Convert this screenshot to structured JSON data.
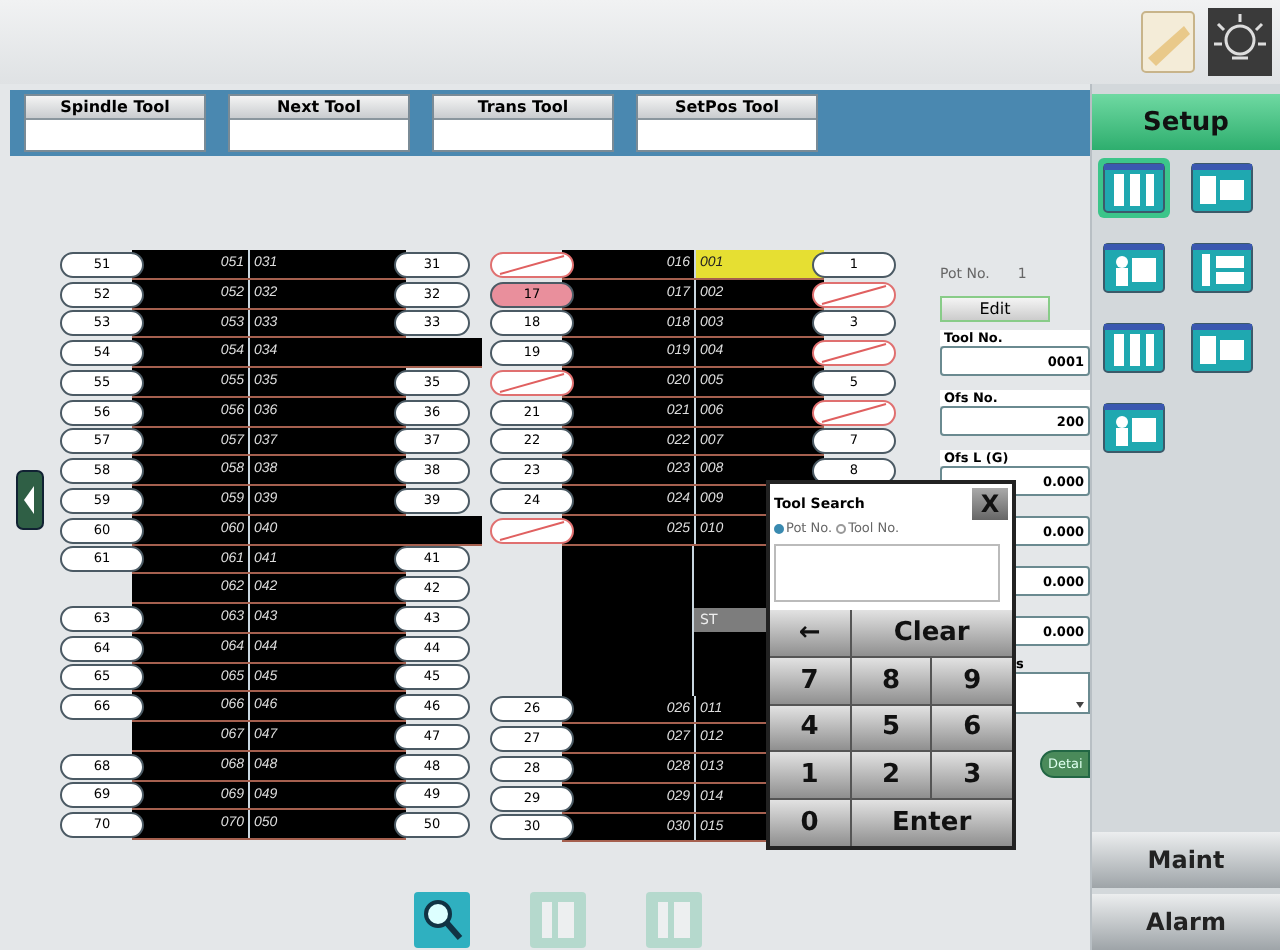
{
  "tool_tabs": [
    {
      "label": "Spindle Tool"
    },
    {
      "label": "Next Tool"
    },
    {
      "label": "Trans Tool"
    },
    {
      "label": "SetPos Tool"
    }
  ],
  "magazine_a": [
    {
      "left": {
        "kind": "number",
        "text": "51"
      },
      "number": "051",
      "tool": "031",
      "right": {
        "kind": "number",
        "text": "31"
      }
    },
    {
      "left": {
        "kind": "number",
        "text": "52"
      },
      "number": "052",
      "tool": "032",
      "right": {
        "kind": "number",
        "text": "32"
      }
    },
    {
      "left": {
        "kind": "number",
        "text": "53"
      },
      "number": "053",
      "tool": "033",
      "right": {
        "kind": "number",
        "text": "33"
      }
    },
    {
      "left": {
        "kind": "number",
        "text": "54"
      },
      "number": "054",
      "tool": "034"
    },
    {
      "left": {
        "kind": "number",
        "text": "55"
      },
      "number": "055",
      "tool": "035",
      "right": {
        "kind": "number",
        "text": "35"
      }
    },
    {
      "left": {
        "kind": "number",
        "text": "56"
      },
      "number": "056",
      "tool": "036",
      "right": {
        "kind": "number",
        "text": "36"
      }
    },
    {
      "left": {
        "kind": "number",
        "text": "57"
      },
      "number": "057",
      "tool": "037",
      "right": {
        "kind": "number",
        "text": "37"
      }
    },
    {
      "left": {
        "kind": "number",
        "text": "58"
      },
      "number": "058",
      "tool": "038",
      "right": {
        "kind": "number",
        "text": "38"
      }
    },
    {
      "left": {
        "kind": "number",
        "text": "59"
      },
      "number": "059",
      "tool": "039",
      "right": {
        "kind": "number",
        "text": "39"
      }
    },
    {
      "left": {
        "kind": "number",
        "text": "60"
      },
      "number": "060",
      "tool": "040"
    },
    {
      "left": {
        "kind": "number",
        "text": "61"
      },
      "number": "061",
      "tool": "041",
      "right": {
        "kind": "number",
        "text": "41"
      }
    },
    {
      "number": "062",
      "tool": "042",
      "right": {
        "kind": "number",
        "text": "42"
      }
    },
    {
      "left": {
        "kind": "number",
        "text": "63"
      },
      "number": "063",
      "tool": "043",
      "right": {
        "kind": "number",
        "text": "43"
      }
    },
    {
      "left": {
        "kind": "number",
        "text": "64"
      },
      "number": "064",
      "tool": "044",
      "right": {
        "kind": "number",
        "text": "44"
      }
    },
    {
      "left": {
        "kind": "number",
        "text": "65"
      },
      "number": "065",
      "tool": "045",
      "right": {
        "kind": "number",
        "text": "45"
      }
    },
    {
      "left": {
        "kind": "number",
        "text": "66"
      },
      "number": "066",
      "tool": "046",
      "right": {
        "kind": "number",
        "text": "46"
      }
    },
    {
      "number": "067",
      "tool": "047",
      "right": {
        "kind": "number",
        "text": "47"
      }
    },
    {
      "left": {
        "kind": "number",
        "text": "68"
      },
      "number": "068",
      "tool": "048",
      "right": {
        "kind": "number",
        "text": "48"
      }
    },
    {
      "left": {
        "kind": "number",
        "text": "69"
      },
      "number": "069",
      "tool": "049",
      "right": {
        "kind": "number",
        "text": "49"
      }
    },
    {
      "left": {
        "kind": "number",
        "text": "70"
      },
      "number": "070",
      "tool": "050",
      "right": {
        "kind": "number",
        "text": "50"
      }
    }
  ],
  "magazine_b": {
    "upper": [
      {
        "left": {
          "kind": "crossed"
        },
        "number": "016",
        "tool": "001",
        "selected": true,
        "right": {
          "kind": "number",
          "text": "1"
        }
      },
      {
        "left": {
          "kind": "number",
          "text": "17",
          "marked": true
        },
        "number": "017",
        "tool": "002",
        "selected": false,
        "right": {
          "kind": "crossed"
        }
      },
      {
        "left": {
          "kind": "number",
          "text": "18"
        },
        "number": "018",
        "tool": "003",
        "selected": false,
        "right": {
          "kind": "number",
          "text": "3"
        }
      },
      {
        "left": {
          "kind": "number",
          "text": "19"
        },
        "number": "019",
        "tool": "004",
        "selected": false,
        "right": {
          "kind": "crossed"
        }
      },
      {
        "left": {
          "kind": "crossed"
        },
        "number": "020",
        "tool": "005",
        "selected": false,
        "right": {
          "kind": "number",
          "text": "5"
        }
      },
      {
        "left": {
          "kind": "number",
          "text": "21"
        },
        "number": "021",
        "tool": "006",
        "selected": false,
        "right": {
          "kind": "crossed"
        }
      },
      {
        "left": {
          "kind": "number",
          "text": "22"
        },
        "number": "022",
        "tool": "007",
        "selected": false,
        "right": {
          "kind": "number",
          "text": "7"
        }
      },
      {
        "left": {
          "kind": "number",
          "text": "23"
        },
        "number": "023",
        "tool": "008",
        "selected": false,
        "right": {
          "kind": "number",
          "text": "8"
        }
      },
      {
        "left": {
          "kind": "number",
          "text": "24"
        },
        "number": "024",
        "tool": "009",
        "selected": false
      },
      {
        "left": {
          "kind": "crossed"
        },
        "number": "025",
        "tool": "010",
        "selected": false
      }
    ],
    "station_label": "ST",
    "lower": [
      {
        "left": {
          "kind": "number",
          "text": "26"
        },
        "number": "026",
        "tool": "011",
        "selected": false
      },
      {
        "left": {
          "kind": "number",
          "text": "27"
        },
        "number": "027",
        "tool": "012",
        "selected": false
      },
      {
        "left": {
          "kind": "number",
          "text": "28"
        },
        "number": "028",
        "tool": "013",
        "selected": false
      },
      {
        "left": {
          "kind": "number",
          "text": "29"
        },
        "number": "029",
        "tool": "014",
        "selected": false
      },
      {
        "left": {
          "kind": "number",
          "text": "30"
        },
        "number": "030",
        "tool": "015",
        "selected": false
      }
    ]
  },
  "detail_panel": {
    "pot_label": "Pot No.",
    "pot_value": "1",
    "edit_button": "Edit",
    "fields": [
      {
        "label": "Tool No.",
        "value": "0001"
      },
      {
        "label": "Ofs No.",
        "value": "200"
      },
      {
        "label": "Ofs L (G)",
        "value": "0.000"
      },
      {
        "value": "0.000"
      },
      {
        "value": "0.000"
      },
      {
        "value": "0.000"
      }
    ],
    "select_label": "s",
    "detail_button": "Detai"
  },
  "tool_search": {
    "title": "Tool Search",
    "close": "X",
    "options": [
      {
        "label": "Pot No.",
        "selected": true
      },
      {
        "label": "Tool No.",
        "selected": false
      }
    ],
    "keys": [
      {
        "label": "←",
        "wide": false
      },
      {
        "label": "Clear",
        "wide": true
      },
      {
        "label": "7",
        "wide": false
      },
      {
        "label": "8",
        "wide": false
      },
      {
        "label": "9",
        "wide": false
      },
      {
        "label": "4",
        "wide": false
      },
      {
        "label": "5",
        "wide": false
      },
      {
        "label": "6",
        "wide": false
      },
      {
        "label": "1",
        "wide": false
      },
      {
        "label": "2",
        "wide": false
      },
      {
        "label": "3",
        "wide": false
      },
      {
        "label": "0",
        "wide": false
      },
      {
        "label": "Enter",
        "wide": true
      }
    ]
  },
  "bottom_toolbar": [
    {
      "kind": "search",
      "disabled": false
    },
    {
      "kind": "list",
      "disabled": true
    },
    {
      "kind": "list",
      "disabled": true
    }
  ],
  "sidebar": {
    "title": "Setup",
    "icons": [
      {
        "selected": true
      },
      {
        "selected": false
      },
      {
        "selected": false
      },
      {
        "selected": false
      },
      {
        "selected": false
      },
      {
        "selected": false
      },
      {
        "selected": false
      }
    ],
    "buttons": [
      {
        "label": "Maint"
      },
      {
        "label": "Alarm"
      }
    ]
  }
}
